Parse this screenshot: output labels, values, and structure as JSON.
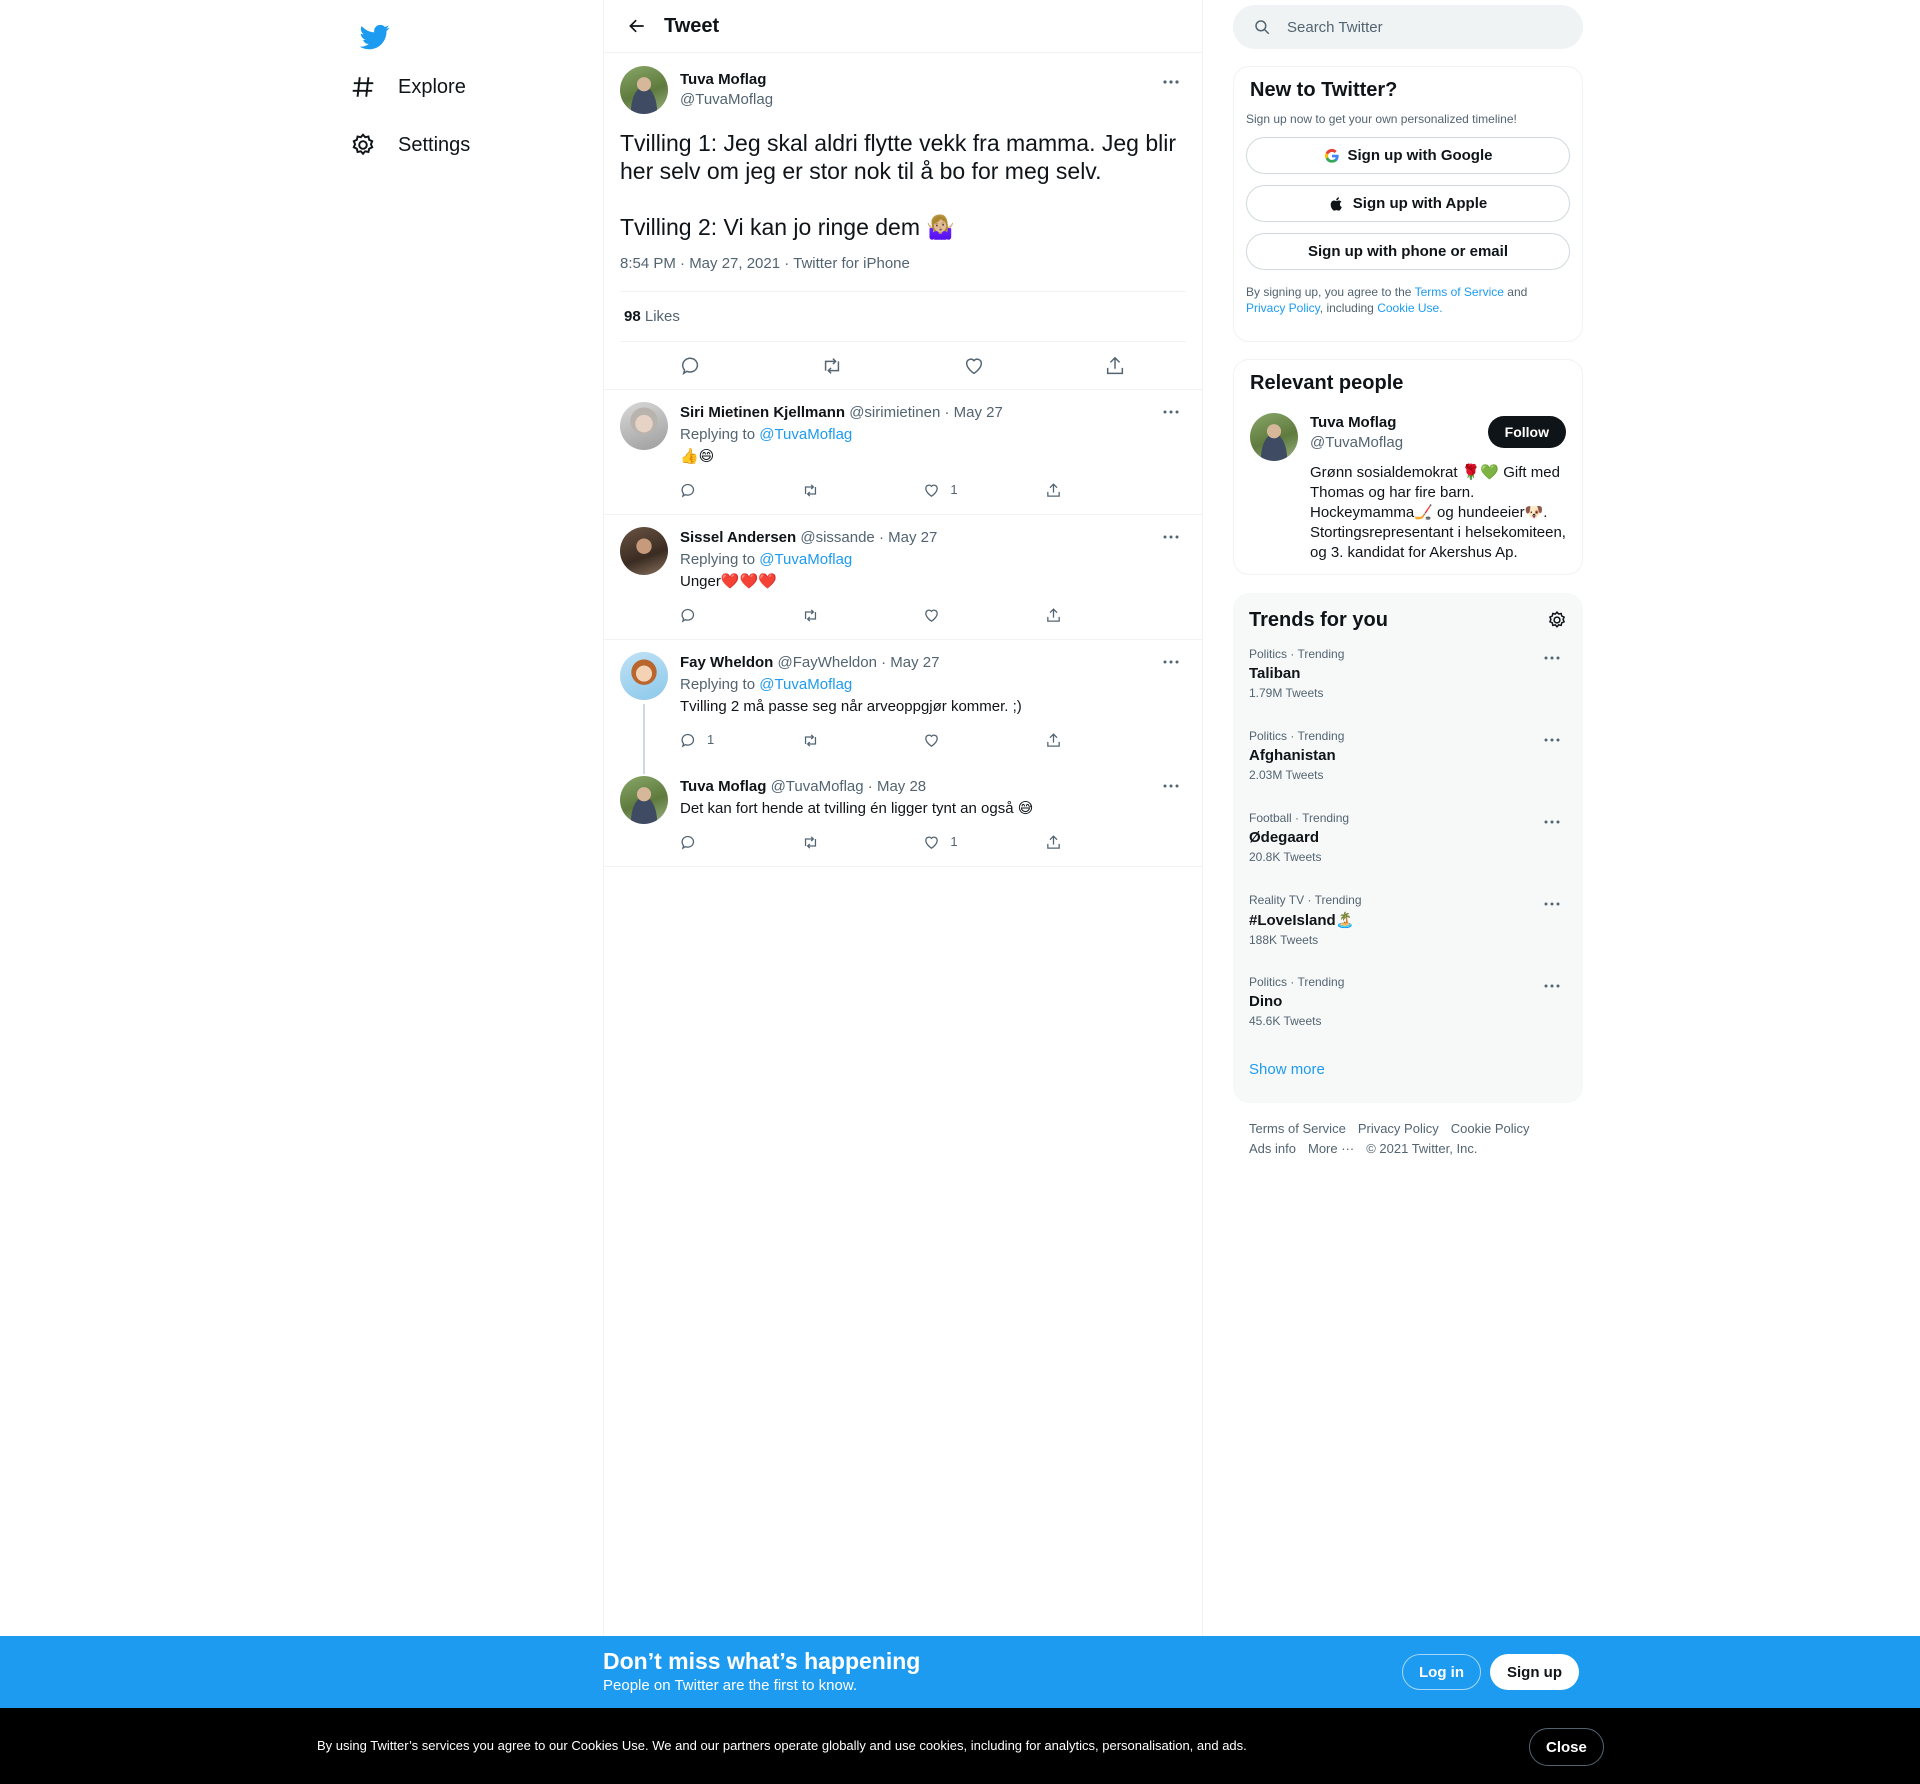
{
  "nav": {
    "logo_icon": "twitter-bird-icon",
    "explore_label": "Explore",
    "settings_label": "Settings"
  },
  "header": {
    "title": "Tweet"
  },
  "tweet": {
    "name": "Tuva Moflag",
    "handle": "@TuvaMoflag",
    "text": "Tvilling 1: Jeg skal aldri flytte vekk fra mamma. Jeg blir her selv om jeg er stor nok til å bo for meg selv.\n\nTvilling 2: Vi kan jo ringe dem 🤷🏼‍♀️",
    "meta": "8:54 PM · May 27, 2021 · Twitter for iPhone",
    "likes_count": "98",
    "likes_label": "Likes"
  },
  "replies": [
    {
      "name": "Siri Mietinen Kjellmann",
      "handle": "@sirimietinen",
      "date": "May 27",
      "replying_prefix": "Replying to",
      "replying_to": "@TuvaMoflag",
      "text": "👍😄",
      "reply_count": "",
      "like_count": "1"
    },
    {
      "name": "Sissel Andersen",
      "handle": "@sissande",
      "date": "May 27",
      "replying_prefix": "Replying to",
      "replying_to": "@TuvaMoflag",
      "text": "Unger❤️❤️❤️",
      "reply_count": "",
      "like_count": ""
    },
    {
      "name": "Fay Wheldon",
      "handle": "@FayWheldon",
      "date": "May 27",
      "replying_prefix": "Replying to",
      "replying_to": "@TuvaMoflag",
      "text": "Tvilling 2 må passe seg når arveoppgjør kommer. ;)",
      "reply_count": "1",
      "like_count": ""
    },
    {
      "name": "Tuva Moflag",
      "handle": "@TuvaMoflag",
      "date": "May 28",
      "text": "Det kan fort hende at tvilling én ligger tynt an også 😅",
      "reply_count": "",
      "like_count": "1"
    }
  ],
  "search": {
    "placeholder": "Search Twitter"
  },
  "signup": {
    "title": "New to Twitter?",
    "subtitle": "Sign up now to get your own personalized timeline!",
    "google_label": "Sign up with Google",
    "apple_label": "Sign up with Apple",
    "phone_label": "Sign up with phone or email",
    "legal_1": "By signing up, you agree to the",
    "terms": "Terms of Service",
    "and": "and",
    "privacy": "Privacy Policy",
    "including": ", including",
    "cookie": "Cookie Use."
  },
  "relevant": {
    "title": "Relevant people",
    "name": "Tuva Moflag",
    "handle": "@TuvaMoflag",
    "follow_label": "Follow",
    "bio": "Grønn sosialdemokrat 🌹💚 Gift med Thomas og har fire barn. Hockeymamma🏒 og hundeeier🐶. Stortingsrepresentant i helsekomiteen, og 3. kandidat for Akershus Ap."
  },
  "trends": {
    "title": "Trends for you",
    "items": [
      {
        "meta": "Politics · Trending",
        "name": "Taliban",
        "count": "1.79M Tweets"
      },
      {
        "meta": "Politics · Trending",
        "name": "Afghanistan",
        "count": "2.03M Tweets"
      },
      {
        "meta": "Football · Trending",
        "name": "Ødegaard",
        "count": "20.8K Tweets"
      },
      {
        "meta": "Reality TV · Trending",
        "name": "#LoveIsland🏝️",
        "count": "188K Tweets"
      },
      {
        "meta": "Politics · Trending",
        "name": "Dino",
        "count": "45.6K Tweets"
      }
    ],
    "show_more": "Show more"
  },
  "footer": {
    "terms": "Terms of Service",
    "privacy": "Privacy Policy",
    "cookie": "Cookie Policy",
    "ads": "Ads info",
    "more": "More ···",
    "copyright": "© 2021 Twitter, Inc."
  },
  "cta": {
    "title": "Don’t miss what’s happening",
    "subtitle": "People on Twitter are the first to know.",
    "login_label": "Log in",
    "signup_label": "Sign up"
  },
  "cookie_banner": {
    "text": "By using Twitter’s services you agree to our Cookies Use. We and our partners operate globally and use cookies, including for analytics, personalisation, and ads.",
    "close_label": "Close"
  },
  "colors": {
    "accent": "#1d9bf0",
    "text": "#0f1419",
    "muted": "#536471",
    "border": "#eff3f4"
  }
}
